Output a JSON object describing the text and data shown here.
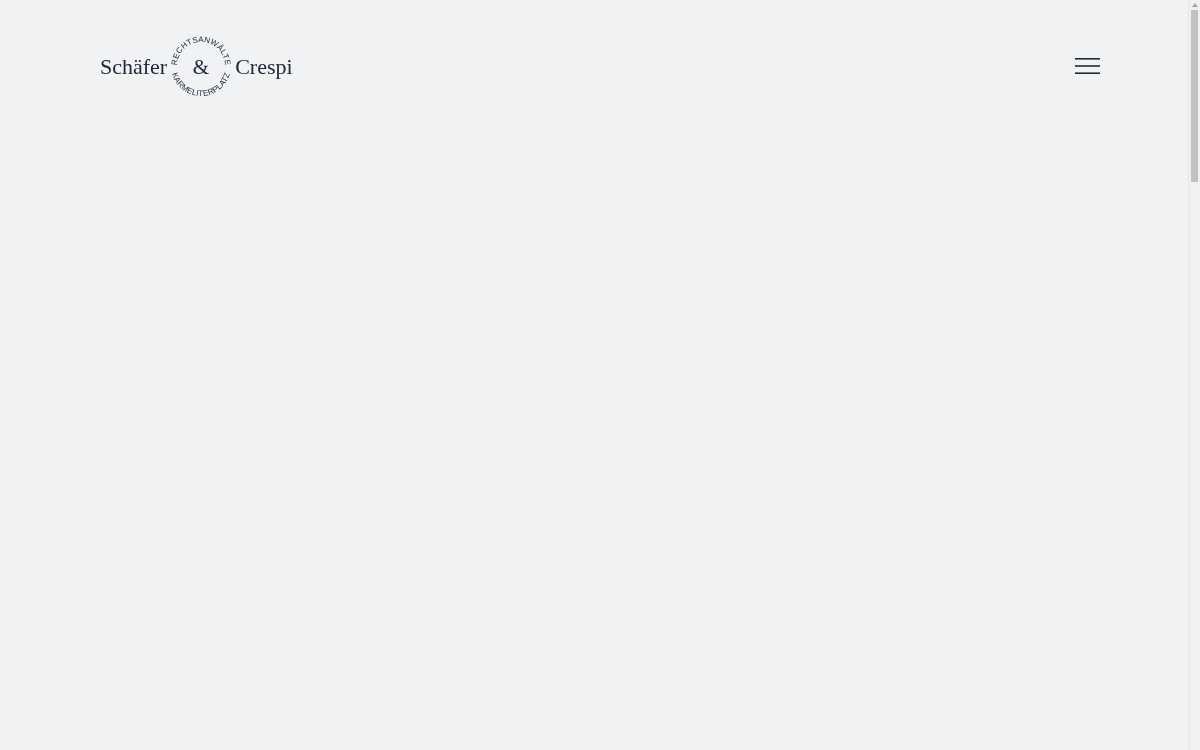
{
  "header": {
    "logo": {
      "name_left": "Schäfer",
      "ampersand": "&",
      "name_right": "Crespi",
      "arc_top": "RECHTSANWÄLTE",
      "arc_bottom": "KARMELITERPLATZ"
    }
  }
}
